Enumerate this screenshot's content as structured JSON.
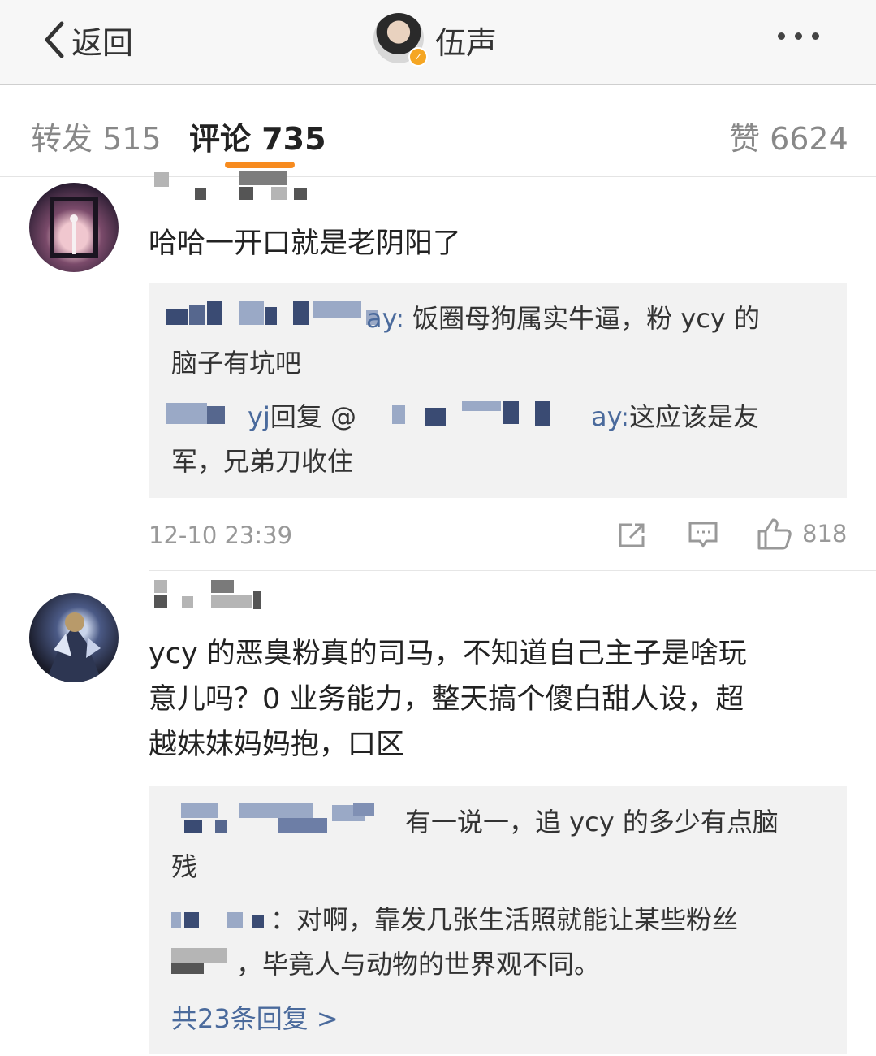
{
  "nav": {
    "back_label": "返回",
    "title": "伍声"
  },
  "tabs": {
    "repost": "转发 515",
    "comment": "评论 735",
    "like": "赞 6624"
  },
  "comments": [
    {
      "text": "哈哈一开口就是老阴阳了",
      "replies": [
        {
          "name_tail": "ay:",
          "text": "饭圈母狗属实牛逼，粉 ycy 的",
          "text2": "脑子有坑吧"
        },
        {
          "name_tail": "yj",
          "mid": "回复 @",
          "name2_tail": "ay:",
          "text": "这应该是友",
          "text2": "军，兄弟刀收住"
        }
      ],
      "time": "12-10 23:39",
      "like_count": "818"
    },
    {
      "text_lines": [
        "ycy 的恶臭粉真的司马，不知道自己主子是啥玩",
        "意儿吗？0 业务能力，整天搞个傻白甜人设，超",
        "越妹妹妈妈抱，口区"
      ],
      "replies": [
        {
          "text": "有一说一，追 ycy 的多少有点脑",
          "text2": "残"
        },
        {
          "text": "：对啊，靠发几张生活照就能让某些粉丝",
          "text2": "，毕竟人与动物的世界观不同。"
        }
      ],
      "more_replies": "共23条回复 >"
    }
  ],
  "colors": {
    "accent": "#f78b1f",
    "link": "#4a6a9c",
    "verified": "#f5a623"
  },
  "icons": [
    "chevron-left-icon",
    "more-dots-icon",
    "share-icon",
    "comment-icon",
    "thumbs-up-icon",
    "verified-icon"
  ]
}
